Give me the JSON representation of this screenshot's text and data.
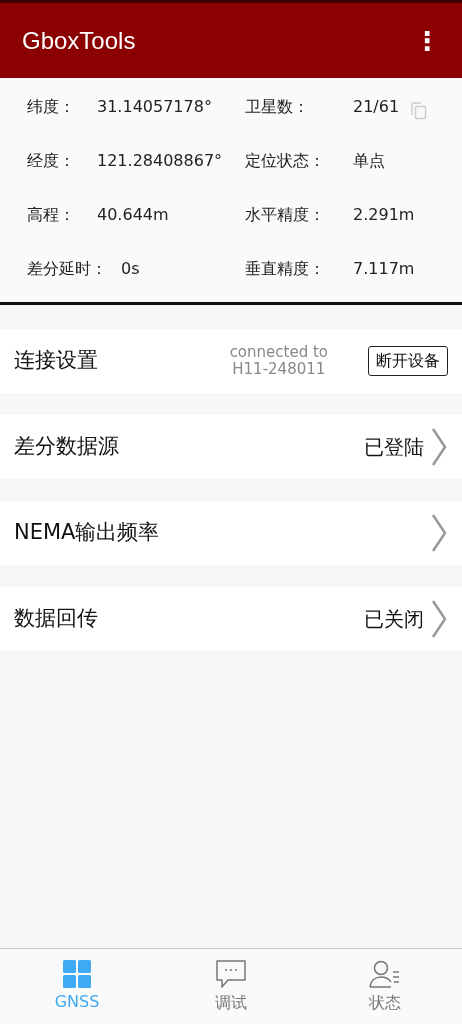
{
  "app_bar": {
    "title": "GboxTools",
    "menu": "⋮"
  },
  "info": [
    {
      "label": "纬度：",
      "value": "31.14057178°"
    },
    {
      "label": "卫星数：",
      "value": "21/61",
      "copy": true
    },
    {
      "label": "经度：",
      "value": "121.28408867°"
    },
    {
      "label": "定位状态：",
      "value": "单点"
    },
    {
      "label": "高程：",
      "value": "40.644m"
    },
    {
      "label": "水平精度：",
      "value": "2.291m"
    },
    {
      "label": "差分延时：",
      "value": "0s"
    },
    {
      "label": "垂直精度：",
      "value": "7.117m"
    }
  ],
  "settings": [
    {
      "kind": "connection",
      "label": "连接设置",
      "status_line_1": "connected to",
      "status_line_2": "H11-248011",
      "button": "断开设备"
    },
    {
      "kind": "link",
      "label": "差分数据源",
      "value": "已登陆"
    },
    {
      "kind": "link",
      "label": "NEMA输出频率"
    },
    {
      "kind": "link",
      "label": "数据回传",
      "value": "已关闭"
    }
  ],
  "bottom_nav": [
    {
      "label": "GNSS",
      "kind": "grid",
      "selected": true
    },
    {
      "label": "调试",
      "kind": "chat",
      "selected": false
    },
    {
      "label": "状态",
      "kind": "person",
      "selected": false
    }
  ]
}
